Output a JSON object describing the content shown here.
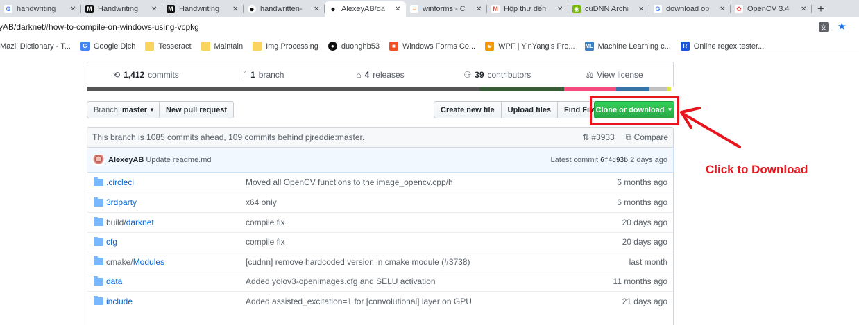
{
  "browser": {
    "tabs": [
      {
        "label": "handwriting",
        "favicon": "G",
        "active": false
      },
      {
        "label": "Handwriting",
        "favicon": "M",
        "active": false
      },
      {
        "label": "Handwriting",
        "favicon": "M",
        "active": false
      },
      {
        "label": "handwritten-",
        "favicon": "github",
        "active": false
      },
      {
        "label": "AlexeyAB/da",
        "favicon": "github",
        "active": true
      },
      {
        "label": "winforms - C",
        "favicon": "stackoverflow",
        "active": false
      },
      {
        "label": "Hộp thư đến",
        "favicon": "gmail",
        "active": false
      },
      {
        "label": "cuDNN Archi",
        "favicon": "nvidia",
        "active": false
      },
      {
        "label": "download op",
        "favicon": "G",
        "active": false
      },
      {
        "label": "OpenCV 3.4",
        "favicon": "opencv",
        "active": false
      }
    ],
    "new_tab": "+",
    "address": "yAB/darknet#how-to-compile-on-windows-using-vcpkg",
    "bookmarks": [
      {
        "label": "Mazii Dictionary - T...",
        "icon": "none"
      },
      {
        "label": "Google Dịch",
        "icon": "translate"
      },
      {
        "label": "Tesseract",
        "icon": "folder"
      },
      {
        "label": "Maintain",
        "icon": "folder"
      },
      {
        "label": "Img Processing",
        "icon": "folder"
      },
      {
        "label": "duonghb53",
        "icon": "github"
      },
      {
        "label": "Windows Forms Co...",
        "icon": "microsoft"
      },
      {
        "label": "WPF | YinYang's Pro...",
        "icon": "yinyang"
      },
      {
        "label": "Machine Learning c...",
        "icon": "ml"
      },
      {
        "label": "Online regex tester...",
        "icon": "regex"
      }
    ]
  },
  "repo": {
    "stats": [
      {
        "icon": "history-icon",
        "number": "1,412",
        "label": "commits"
      },
      {
        "icon": "branch-icon",
        "number": "1",
        "label": "branch"
      },
      {
        "icon": "tag-icon",
        "number": "4",
        "label": "releases"
      },
      {
        "icon": "people-icon",
        "number": "39",
        "label": "contributors"
      },
      {
        "icon": "law-icon",
        "number": "",
        "label": "View license"
      }
    ],
    "language_colors": [
      "#555555",
      "#3a5a3a",
      "#f34b7d",
      "#3572a5",
      "#c0c0c0",
      "#dde44e"
    ],
    "branch_button": {
      "prefix": "Branch:",
      "value": "master"
    },
    "new_pr": "New pull request",
    "create_file": "Create new file",
    "upload_files": "Upload files",
    "find_file": "Find File",
    "clone": "Clone or download",
    "ahead_text": "This branch is 1085 commits ahead, 109 commits behind pjreddie:master.",
    "pr_link": "#3933",
    "compare": "Compare",
    "latest": {
      "author": "AlexeyAB",
      "message": "Update readme.md",
      "prefix": "Latest commit",
      "sha": "6f4d93b",
      "age": "2 days ago"
    },
    "files": [
      {
        "dim": "",
        "name": ".circleci",
        "message": "Moved all OpenCV functions to the image_opencv.cpp/h",
        "age": "6 months ago"
      },
      {
        "dim": "",
        "name": "3rdparty",
        "message": "x64 only",
        "age": "6 months ago"
      },
      {
        "dim": "build/",
        "name": "darknet",
        "message": "compile fix",
        "age": "20 days ago"
      },
      {
        "dim": "",
        "name": "cfg",
        "message": "compile fix",
        "age": "20 days ago"
      },
      {
        "dim": "cmake/",
        "name": "Modules",
        "message": "[cudnn] remove hardcoded version in cmake module (#3738)",
        "age": "last month"
      },
      {
        "dim": "",
        "name": "data",
        "message": "Added yolov3-openimages.cfg and SELU activation",
        "age": "11 months ago"
      },
      {
        "dim": "",
        "name": "include",
        "message": "Added assisted_excitation=1 for [convolutional] layer on GPU",
        "age": "21 days ago"
      }
    ]
  },
  "annotation": {
    "text": "Click to Download",
    "color": "#e8141e"
  }
}
